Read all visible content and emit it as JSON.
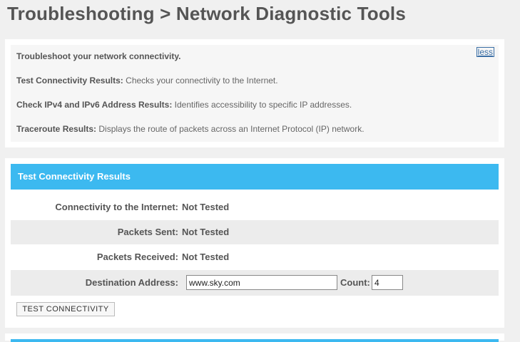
{
  "header": {
    "title": "Troubleshooting > Network Diagnostic Tools"
  },
  "info": {
    "intro": "Troubleshoot your network connectivity.",
    "less_link": "less",
    "items": [
      {
        "label": "Test Connectivity Results:",
        "desc": " Checks your connectivity to the Internet."
      },
      {
        "label": "Check IPv4 and IPv6 Address Results:",
        "desc": " Identifies accessibility to specific IP addresses."
      },
      {
        "label": "Traceroute Results:",
        "desc": " Displays the route of packets across an Internet Protocol (IP) network."
      }
    ]
  },
  "connectivity": {
    "title": "Test Connectivity Results",
    "rows": [
      {
        "label": "Connectivity to the Internet:",
        "value": "Not Tested"
      },
      {
        "label": "Packets Sent:",
        "value": "Not Tested"
      },
      {
        "label": "Packets Received:",
        "value": "Not Tested"
      }
    ],
    "destination_label": "Destination Address:",
    "destination_value": "www.sky.com",
    "count_label": "Count:",
    "count_value": "4",
    "button_label": "TEST CONNECTIVITY"
  },
  "colors": {
    "accent": "#3cb9f0",
    "background": "#f0f0f0",
    "link": "#3a6ea5"
  }
}
